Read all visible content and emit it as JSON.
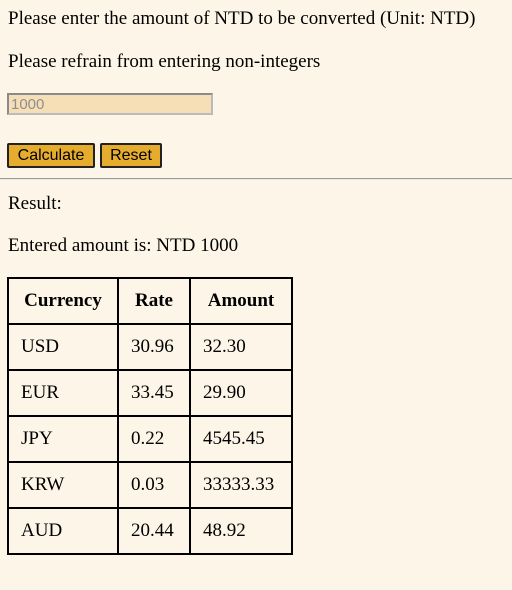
{
  "instructions": {
    "line1": "Please enter the amount of NTD to be converted (Unit: NTD)",
    "line2": "Please refrain from entering non-integers"
  },
  "amount_input": {
    "value": "",
    "placeholder": "1000"
  },
  "buttons": {
    "calculate": "Calculate",
    "reset": "Reset"
  },
  "result": {
    "label": "Result:",
    "entered_prefix": "Entered amount is: NTD ",
    "entered_amount": "1000"
  },
  "table": {
    "headers": [
      "Currency",
      "Rate",
      "Amount"
    ],
    "rows": [
      {
        "currency": "USD",
        "rate": "30.96",
        "amount": "32.30"
      },
      {
        "currency": "EUR",
        "rate": "33.45",
        "amount": "29.90"
      },
      {
        "currency": "JPY",
        "rate": "0.22",
        "amount": "4545.45"
      },
      {
        "currency": "KRW",
        "rate": "0.03",
        "amount": "33333.33"
      },
      {
        "currency": "AUD",
        "rate": "20.44",
        "amount": "48.92"
      }
    ]
  },
  "colors": {
    "background": "#fdf5e7",
    "input_background": "#f6deb6",
    "button_background": "#e5ac2e"
  }
}
